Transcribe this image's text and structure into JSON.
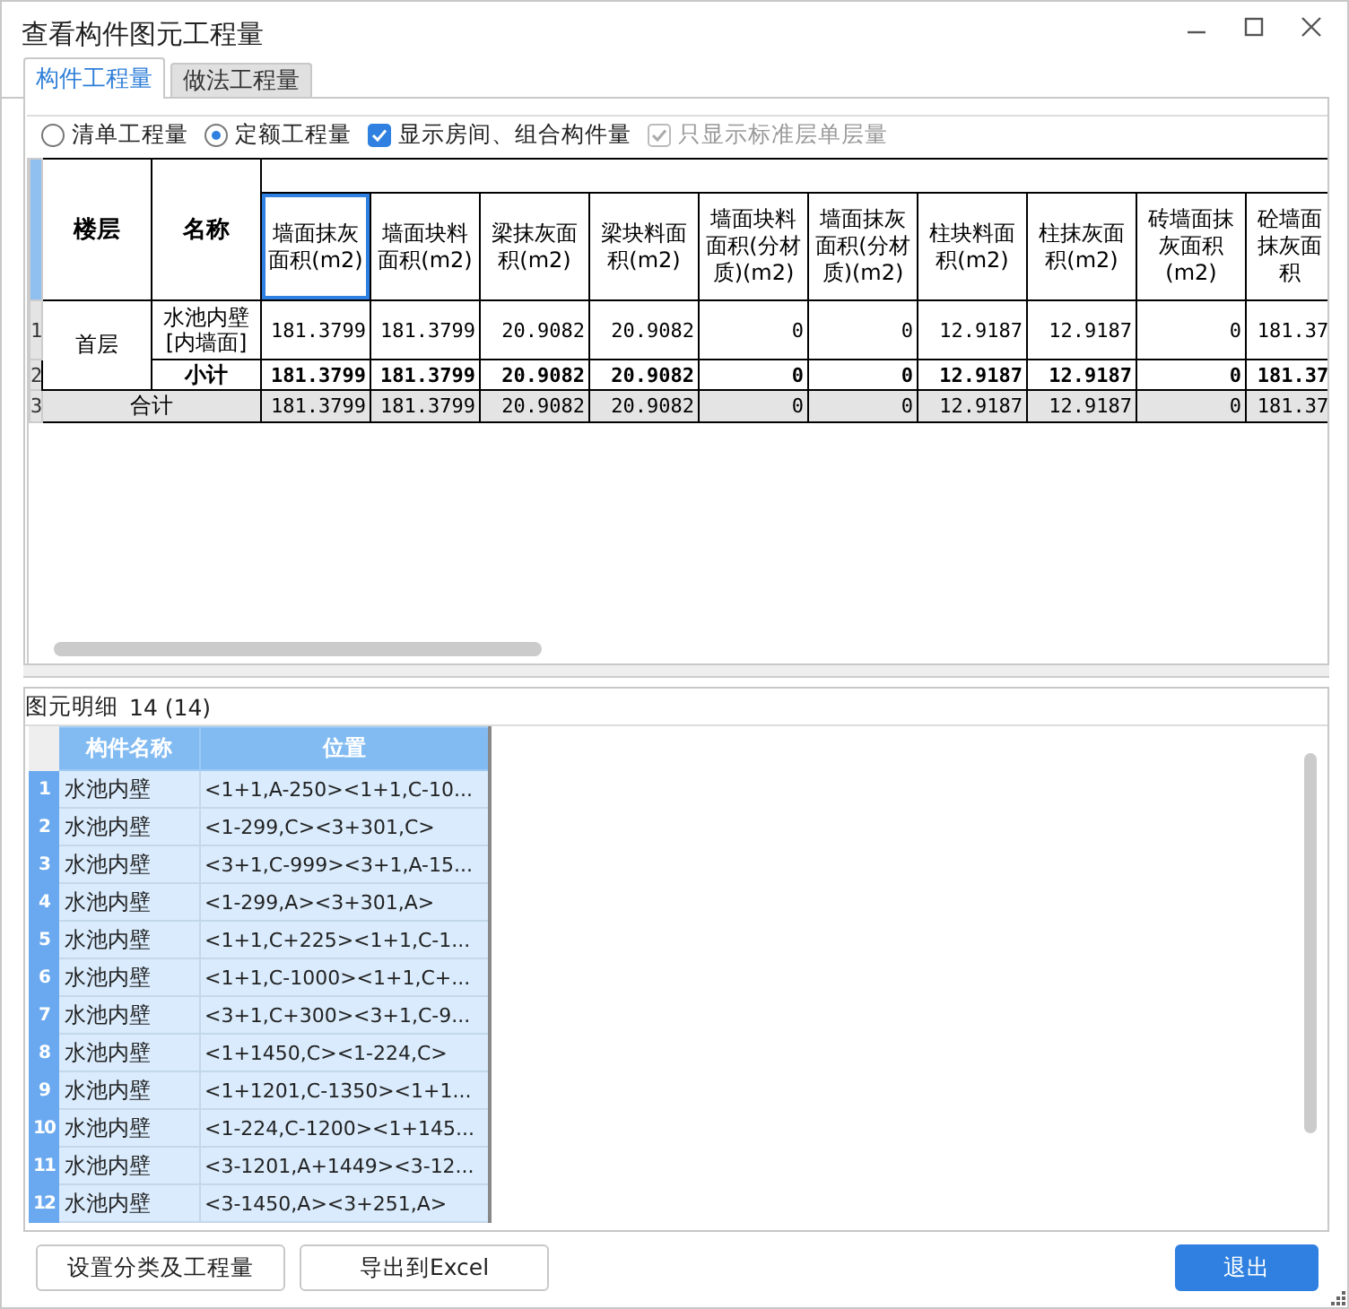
{
  "window": {
    "title": "查看构件图元工程量"
  },
  "tabs": [
    {
      "label": "构件工程量",
      "selected": true
    },
    {
      "label": "做法工程量",
      "selected": false
    }
  ],
  "options": [
    {
      "kind": "radio",
      "label": "清单工程量",
      "checked": false,
      "disabled": false
    },
    {
      "kind": "radio",
      "label": "定额工程量",
      "checked": true,
      "disabled": false
    },
    {
      "kind": "checkbox",
      "label": "显示房间、组合构件量",
      "checked": true,
      "disabled": false
    },
    {
      "kind": "checkbox",
      "label": "只显示标准层单层量",
      "checked": true,
      "disabled": true
    }
  ],
  "quantity_table": {
    "floor_heading": "楼层",
    "name_heading": "名称",
    "columns": [
      {
        "label": "墙面抹灰面积(m2)",
        "selected": true
      },
      {
        "label": "墙面块料面积(m2)",
        "selected": false
      },
      {
        "label": "梁抹灰面积(m2)",
        "selected": false
      },
      {
        "label": "梁块料面积(m2)",
        "selected": false
      },
      {
        "label": "墙面块料面积(分材质)(m2)",
        "selected": false
      },
      {
        "label": "墙面抹灰面积(分材质)(m2)",
        "selected": false
      },
      {
        "label": "柱块料面积(m2)",
        "selected": false
      },
      {
        "label": "柱抹灰面积(m2)",
        "selected": false
      },
      {
        "label": "砖墙面抹灰面积(m2)",
        "selected": false
      },
      {
        "label": "砼墙面抹灰面积",
        "selected": false
      }
    ],
    "floors": [
      {
        "floor": "首层",
        "rows": [
          {
            "kind": "item",
            "row_number": "1",
            "name": "水池内壁\n[内墙面]",
            "values": [
              "181.3799",
              "181.3799",
              "20.9082",
              "20.9082",
              "0",
              "0",
              "12.9187",
              "12.9187",
              "0",
              "181.37"
            ]
          },
          {
            "kind": "subtotal",
            "row_number": "2",
            "name": "小计",
            "values": [
              "181.3799",
              "181.3799",
              "20.9082",
              "20.9082",
              "0",
              "0",
              "12.9187",
              "12.9187",
              "0",
              "181.37"
            ]
          }
        ]
      }
    ],
    "total": {
      "row_number": "3",
      "label": "合计",
      "values": [
        "181.3799",
        "181.3799",
        "20.9082",
        "20.9082",
        "0",
        "0",
        "12.9187",
        "12.9187",
        "0",
        "181.37"
      ]
    }
  },
  "detail": {
    "title": "图元明细",
    "count": "14 (14)",
    "columns": [
      "构件名称",
      "位置"
    ],
    "rows": [
      {
        "row_number": "1",
        "name": "水池内壁",
        "position": "<1+1,A-250><1+1,C-10..."
      },
      {
        "row_number": "2",
        "name": "水池内壁",
        "position": "<1-299,C><3+301,C>"
      },
      {
        "row_number": "3",
        "name": "水池内壁",
        "position": "<3+1,C-999><3+1,A-15..."
      },
      {
        "row_number": "4",
        "name": "水池内壁",
        "position": "<1-299,A><3+301,A>"
      },
      {
        "row_number": "5",
        "name": "水池内壁",
        "position": "<1+1,C+225><1+1,C-1..."
      },
      {
        "row_number": "6",
        "name": "水池内壁",
        "position": "<1+1,C-1000><1+1,C+..."
      },
      {
        "row_number": "7",
        "name": "水池内壁",
        "position": "<3+1,C+300><3+1,C-9..."
      },
      {
        "row_number": "8",
        "name": "水池内壁",
        "position": "<1+1450,C><1-224,C>"
      },
      {
        "row_number": "9",
        "name": "水池内壁",
        "position": "<1+1201,C-1350><1+1..."
      },
      {
        "row_number": "10",
        "name": "水池内壁",
        "position": "<1-224,C-1200><1+145..."
      },
      {
        "row_number": "11",
        "name": "水池内壁",
        "position": "<3-1201,A+1449><3-12..."
      },
      {
        "row_number": "12",
        "name": "水池内壁",
        "position": "<3-1450,A><3+251,A>"
      }
    ]
  },
  "buttons": [
    {
      "kind": "secondary",
      "label": "设置分类及工程量"
    },
    {
      "kind": "secondary",
      "label": "导出到Excel"
    },
    {
      "kind": "primary",
      "label": "退出"
    }
  ]
}
